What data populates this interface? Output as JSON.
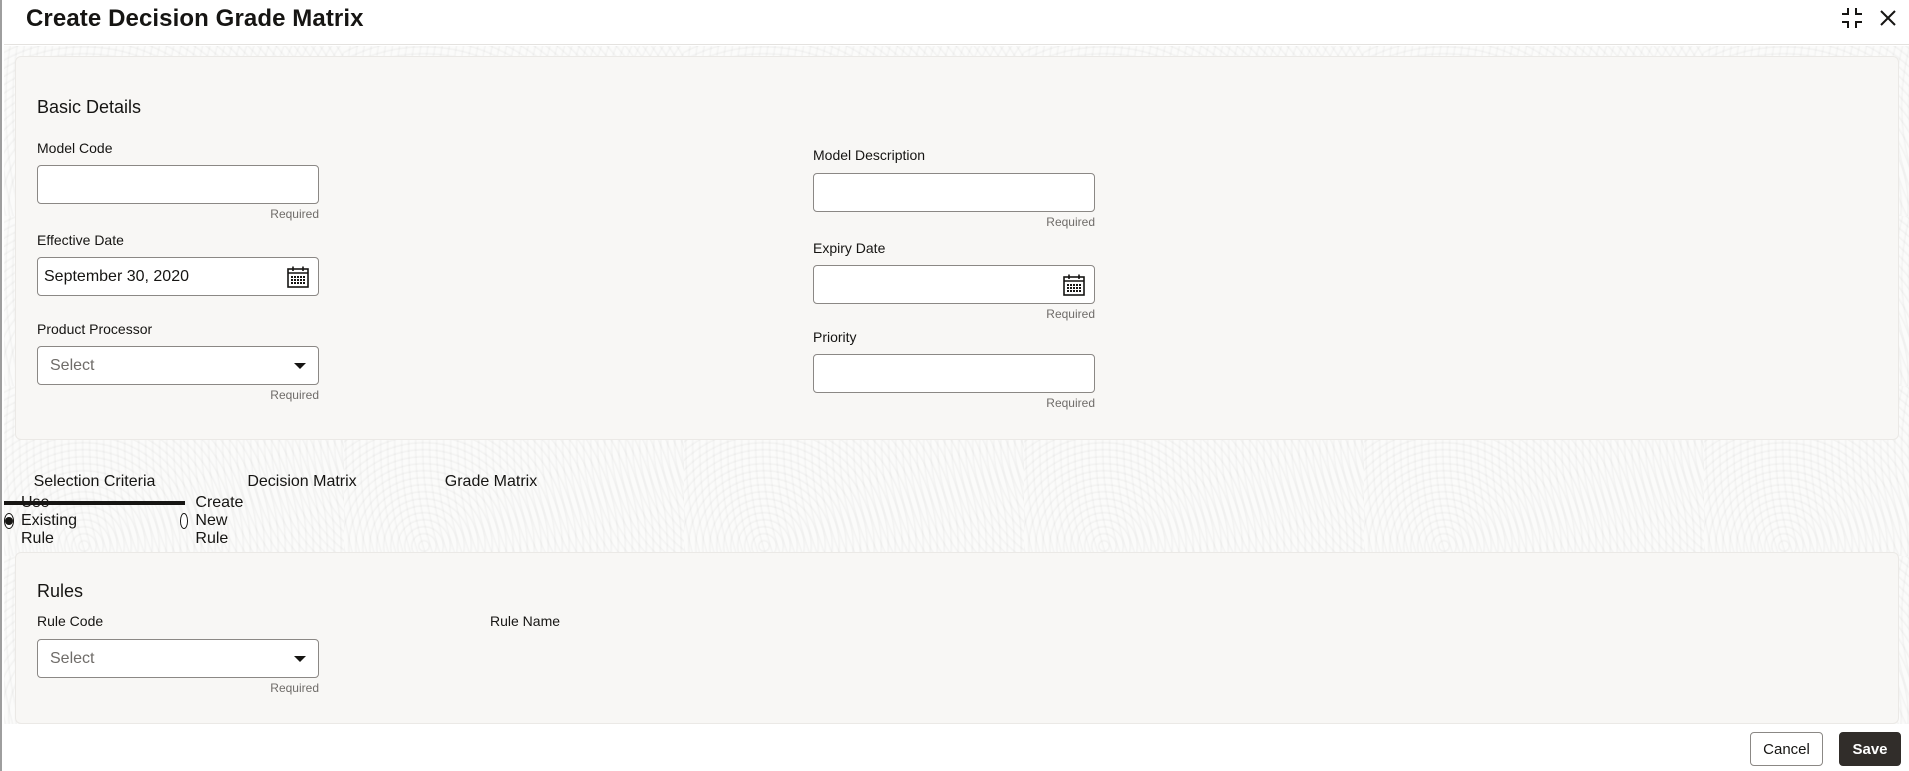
{
  "window": {
    "title": "Create Decision Grade Matrix",
    "icons": {
      "minimize": "collapse-arrows-icon",
      "close": "close-icon"
    }
  },
  "basic_details": {
    "title": "Basic Details",
    "fields": {
      "model_code": {
        "label": "Model Code",
        "value": "",
        "hint": "Required"
      },
      "model_description": {
        "label": "Model Description",
        "value": "",
        "hint": "Required"
      },
      "effective_date": {
        "label": "Effective Date",
        "value": "September 30, 2020",
        "icon": "calendar-icon"
      },
      "expiry_date": {
        "label": "Expiry Date",
        "value": "",
        "hint": "Required",
        "icon": "calendar-icon"
      },
      "product_processor": {
        "label": "Product Processor",
        "placeholder": "Select",
        "hint": "Required"
      },
      "priority": {
        "label": "Priority",
        "value": "",
        "hint": "Required"
      }
    }
  },
  "tabs": [
    {
      "label": "Selection Criteria",
      "active": true
    },
    {
      "label": "Decision Matrix",
      "active": false
    },
    {
      "label": "Grade Matrix",
      "active": false
    }
  ],
  "rule_options": [
    {
      "label": "Use Existing Rule",
      "selected": true
    },
    {
      "label": "Create New Rule",
      "selected": false
    }
  ],
  "rules": {
    "title": "Rules",
    "rule_code": {
      "label": "Rule Code",
      "placeholder": "Select",
      "hint": "Required"
    },
    "rule_name": {
      "label": "Rule Name"
    }
  },
  "footer": {
    "cancel_label": "Cancel",
    "save_label": "Save"
  }
}
